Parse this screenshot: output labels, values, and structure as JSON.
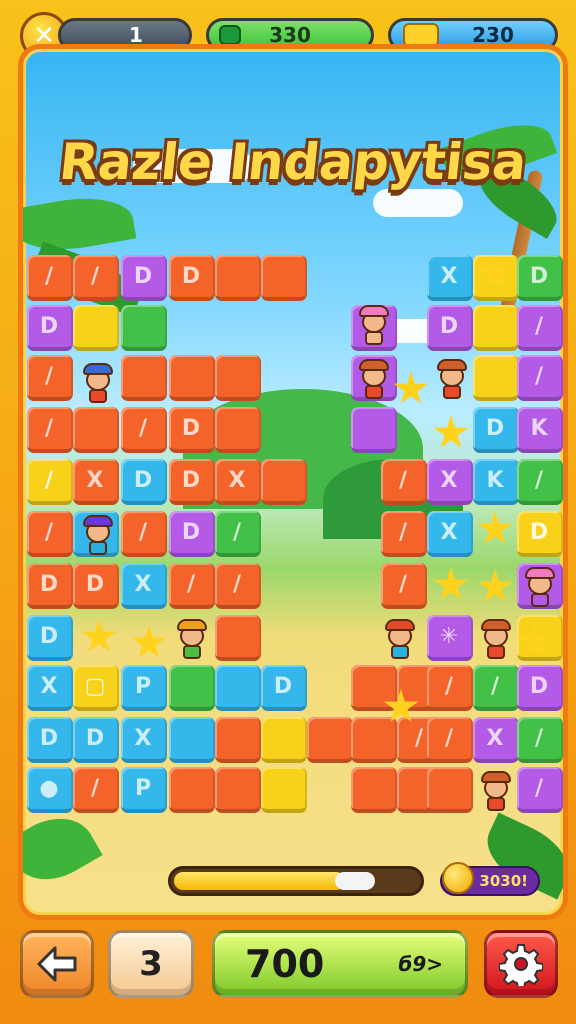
{
  "game_title": "Razle Indapytisa",
  "hud": {
    "close_icon": "✕",
    "level_value": "1",
    "gems_value": "330",
    "coins_value": "230",
    "colors": {
      "gems": "#3cc43c",
      "coins": "#33a8e8",
      "level": "#4a5a6a"
    }
  },
  "board": {
    "tiles": [
      {
        "c": "orange",
        "g": "/"
      },
      {
        "c": "orange",
        "g": "/"
      },
      {
        "c": "purple",
        "g": "D"
      },
      {
        "c": "orange",
        "g": "D"
      },
      {
        "c": "orange",
        "g": ""
      },
      {
        "c": "orange",
        "g": ""
      },
      {
        "c": "purple",
        "g": "D"
      },
      {
        "c": "yellow",
        "g": ""
      },
      {
        "c": "green",
        "g": ""
      },
      {
        "c": "orange",
        "g": "/"
      },
      {
        "c": "orange",
        "g": ""
      },
      {
        "c": "orange",
        "g": ""
      },
      {
        "c": "orange",
        "g": ""
      },
      {
        "c": "orange",
        "g": "/"
      },
      {
        "c": "orange",
        "g": ""
      },
      {
        "c": "orange",
        "g": "/"
      },
      {
        "c": "orange",
        "g": "D"
      },
      {
        "c": "orange",
        "g": ""
      },
      {
        "c": "yellow",
        "g": "/"
      },
      {
        "c": "orange",
        "g": "X"
      },
      {
        "c": "blue",
        "g": "D"
      },
      {
        "c": "orange",
        "g": "D"
      },
      {
        "c": "orange",
        "g": "X"
      },
      {
        "c": "orange",
        "g": ""
      },
      {
        "c": "orange",
        "g": "/"
      },
      {
        "c": "blue",
        "g": ""
      },
      {
        "c": "orange",
        "g": "/"
      },
      {
        "c": "purple",
        "g": "D"
      },
      {
        "c": "green",
        "g": "/"
      },
      {
        "c": "orange",
        "g": "D"
      },
      {
        "c": "orange",
        "g": "D"
      },
      {
        "c": "blue",
        "g": "X"
      },
      {
        "c": "orange",
        "g": "/"
      },
      {
        "c": "orange",
        "g": "/"
      },
      {
        "c": "blue",
        "g": "D"
      },
      {
        "c": "orange",
        "g": ""
      },
      {
        "c": "blue",
        "g": "X"
      },
      {
        "c": "yellow",
        "g": "▢"
      },
      {
        "c": "blue",
        "g": "P"
      },
      {
        "c": "green",
        "g": ""
      },
      {
        "c": "blue",
        "g": ""
      },
      {
        "c": "blue",
        "g": "D"
      },
      {
        "c": "blue",
        "g": "D"
      },
      {
        "c": "blue",
        "g": "D"
      },
      {
        "c": "blue",
        "g": "X"
      },
      {
        "c": "blue",
        "g": ""
      },
      {
        "c": "orange",
        "g": ""
      },
      {
        "c": "yellow",
        "g": ""
      },
      {
        "c": "orange",
        "g": ""
      },
      {
        "c": "blue",
        "g": "●"
      },
      {
        "c": "orange",
        "g": "/"
      },
      {
        "c": "blue",
        "g": "P"
      },
      {
        "c": "orange",
        "g": ""
      },
      {
        "c": "orange",
        "g": ""
      },
      {
        "c": "yellow",
        "g": ""
      },
      {
        "c": "purple",
        "g": ""
      },
      {
        "c": "purple",
        "g": ""
      },
      {
        "c": "purple",
        "g": ""
      },
      {
        "c": "blue",
        "g": "X"
      },
      {
        "c": "yellow",
        "g": "★"
      },
      {
        "c": "green",
        "g": "D"
      },
      {
        "c": "purple",
        "g": "D"
      },
      {
        "c": "yellow",
        "g": ""
      },
      {
        "c": "purple",
        "g": "/"
      },
      {
        "c": "yellow",
        "g": ""
      },
      {
        "c": "purple",
        "g": "/"
      },
      {
        "c": "blue",
        "g": "D"
      },
      {
        "c": "purple",
        "g": "K"
      },
      {
        "c": "orange",
        "g": "/"
      },
      {
        "c": "purple",
        "g": "X"
      },
      {
        "c": "blue",
        "g": "K"
      },
      {
        "c": "green",
        "g": "/"
      },
      {
        "c": "orange",
        "g": "/"
      },
      {
        "c": "blue",
        "g": "X"
      },
      {
        "c": "yellow",
        "g": "D"
      },
      {
        "c": "orange",
        "g": "/"
      },
      {
        "c": "purple",
        "g": ""
      },
      {
        "c": "purple",
        "g": "✳"
      },
      {
        "c": "yellow",
        "g": ""
      },
      {
        "c": "orange",
        "g": ""
      },
      {
        "c": "orange",
        "g": ""
      },
      {
        "c": "orange",
        "g": "/"
      },
      {
        "c": "green",
        "g": "/"
      },
      {
        "c": "purple",
        "g": "D"
      },
      {
        "c": "orange",
        "g": ""
      },
      {
        "c": "orange",
        "g": "/"
      },
      {
        "c": "orange",
        "g": "/"
      },
      {
        "c": "purple",
        "g": "X"
      },
      {
        "c": "green",
        "g": "/"
      },
      {
        "c": "orange",
        "g": ""
      },
      {
        "c": "orange",
        "g": ""
      },
      {
        "c": "orange",
        "g": ""
      },
      {
        "c": "purple",
        "g": "/"
      }
    ]
  },
  "progress": {
    "fraction": 0.7
  },
  "coin_badge": "3030!",
  "bottom": {
    "back_icon": "arrow-left-icon",
    "moves_value": "3",
    "score_value": "700",
    "score_suffix": "б9>",
    "settings_icon": "gear-icon",
    "colors": {
      "back": "#f59a3a",
      "moves": "#fde2c0",
      "score": "#a8e03a",
      "settings": "#e8202a"
    }
  }
}
